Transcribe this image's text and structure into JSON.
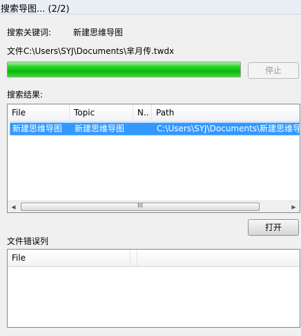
{
  "window": {
    "title": "搜索导图... (2/2)"
  },
  "search": {
    "keyword_label": "搜索关键词:",
    "keyword_value": "新建思维导图",
    "file_label": "文件C:\\Users\\SYJ\\Documents\\芈月传.twdx"
  },
  "progress": {
    "percent": 100,
    "color": "#11c411"
  },
  "buttons": {
    "stop_label": "停止",
    "open_label": "打开"
  },
  "results": {
    "label": "搜索结果:",
    "columns": [
      "File",
      "Topic",
      "N..",
      "Path"
    ],
    "rows": [
      {
        "file": "新建思维导图",
        "topic": "新建思维导图",
        "n": "",
        "path": "C:\\Users\\SYJ\\Documents\\新建思维导图"
      }
    ],
    "selected_color": "#3399ff",
    "scroll_thumb_glyph": "III"
  },
  "errors": {
    "label": "文件错误列",
    "columns": [
      "File"
    ]
  }
}
